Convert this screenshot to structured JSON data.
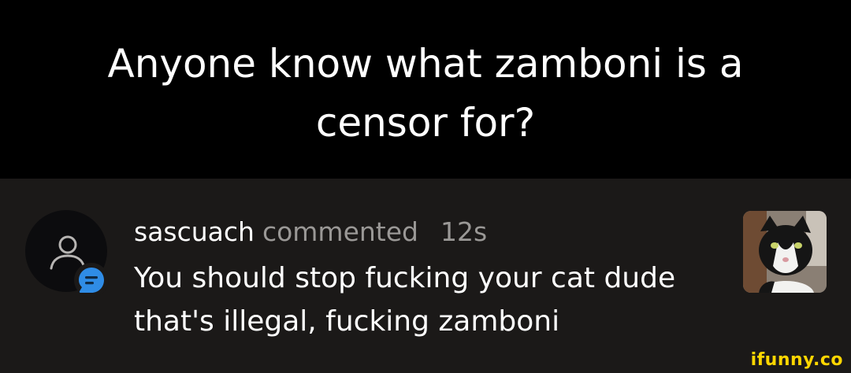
{
  "caption": {
    "line1": "Anyone know what zamboni is a",
    "line2": "censor for?"
  },
  "notification": {
    "username": "sascuach",
    "action": "commented",
    "time": "12s",
    "comment": "You should stop fucking your cat dude that's illegal, fucking zamboni",
    "avatar_icon": "user-icon",
    "badge_icon": "comment-bubble-icon",
    "badge_color": "#2f8ce6"
  },
  "thumbnail": {
    "icon": "cat-photo"
  },
  "watermark": {
    "text": "ifunny.co",
    "color": "#ffd600"
  }
}
